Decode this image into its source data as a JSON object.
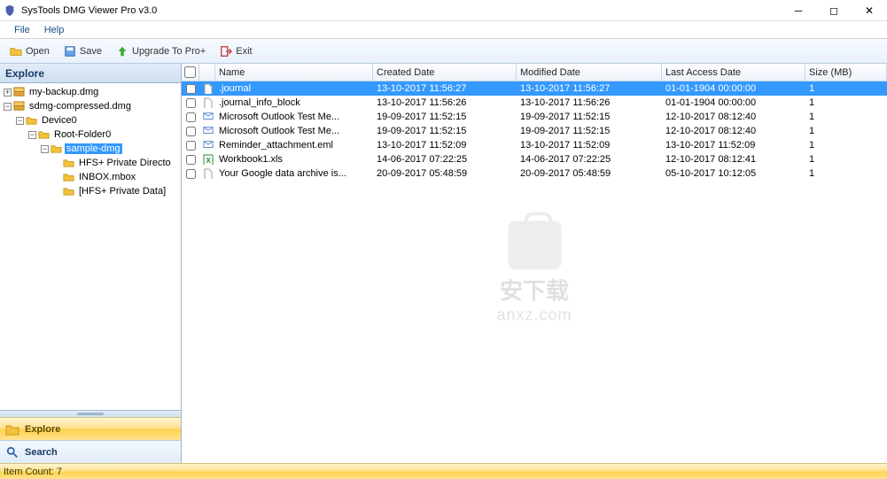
{
  "title": "SysTools DMG Viewer Pro v3.0",
  "menu": {
    "file": "File",
    "help": "Help"
  },
  "toolbar": {
    "open": "Open",
    "save": "Save",
    "upgrade": "Upgrade To Pro+",
    "exit": "Exit"
  },
  "sidebar": {
    "header": "Explore",
    "nav": {
      "explore": "Explore",
      "search": "Search"
    }
  },
  "tree": [
    {
      "indent": 0,
      "exp": "+",
      "icon": "dmg",
      "label": "my-backup.dmg"
    },
    {
      "indent": 0,
      "exp": "-",
      "icon": "dmg",
      "label": "sdmg-compressed.dmg"
    },
    {
      "indent": 1,
      "exp": "-",
      "icon": "folder",
      "label": "Device0"
    },
    {
      "indent": 2,
      "exp": "-",
      "icon": "folder",
      "label": "Root-Folder0"
    },
    {
      "indent": 3,
      "exp": "-",
      "icon": "folder",
      "label": "sample-dmg",
      "selected": true
    },
    {
      "indent": 4,
      "exp": "",
      "icon": "folder",
      "label": "HFS+ Private Directo"
    },
    {
      "indent": 4,
      "exp": "",
      "icon": "folder",
      "label": "INBOX.mbox"
    },
    {
      "indent": 4,
      "exp": "",
      "icon": "folder",
      "label": "[HFS+ Private Data]"
    }
  ],
  "columns": {
    "name": "Name",
    "created": "Created Date",
    "modified": "Modified Date",
    "access": "Last Access Date",
    "size": "Size (MB)"
  },
  "files": [
    {
      "icon": "file",
      "name": ".journal",
      "created": "13-10-2017 11:56:27",
      "modified": "13-10-2017 11:56:27",
      "access": "01-01-1904 00:00:00",
      "size": "1",
      "selected": true
    },
    {
      "icon": "file",
      "name": ".journal_info_block",
      "created": "13-10-2017 11:56:26",
      "modified": "13-10-2017 11:56:26",
      "access": "01-01-1904 00:00:00",
      "size": "1"
    },
    {
      "icon": "mail",
      "name": "Microsoft Outlook Test Me...",
      "created": "19-09-2017 11:52:15",
      "modified": "19-09-2017 11:52:15",
      "access": "12-10-2017 08:12:40",
      "size": "1"
    },
    {
      "icon": "mail",
      "name": "Microsoft Outlook Test Me...",
      "created": "19-09-2017 11:52:15",
      "modified": "19-09-2017 11:52:15",
      "access": "12-10-2017 08:12:40",
      "size": "1"
    },
    {
      "icon": "mail",
      "name": "Reminder_attachment.eml",
      "created": "13-10-2017 11:52:09",
      "modified": "13-10-2017 11:52:09",
      "access": "13-10-2017 11:52:09",
      "size": "1"
    },
    {
      "icon": "excel",
      "name": "Workbook1.xls",
      "created": "14-06-2017 07:22:25",
      "modified": "14-06-2017 07:22:25",
      "access": "12-10-2017 08:12:41",
      "size": "1"
    },
    {
      "icon": "file",
      "name": "Your Google data archive is...",
      "created": "20-09-2017 05:48:59",
      "modified": "20-09-2017 05:48:59",
      "access": "05-10-2017 10:12:05",
      "size": "1"
    }
  ],
  "status": "Item Count: 7",
  "watermark": {
    "line1": "安下载",
    "line2": "anxz.com"
  }
}
